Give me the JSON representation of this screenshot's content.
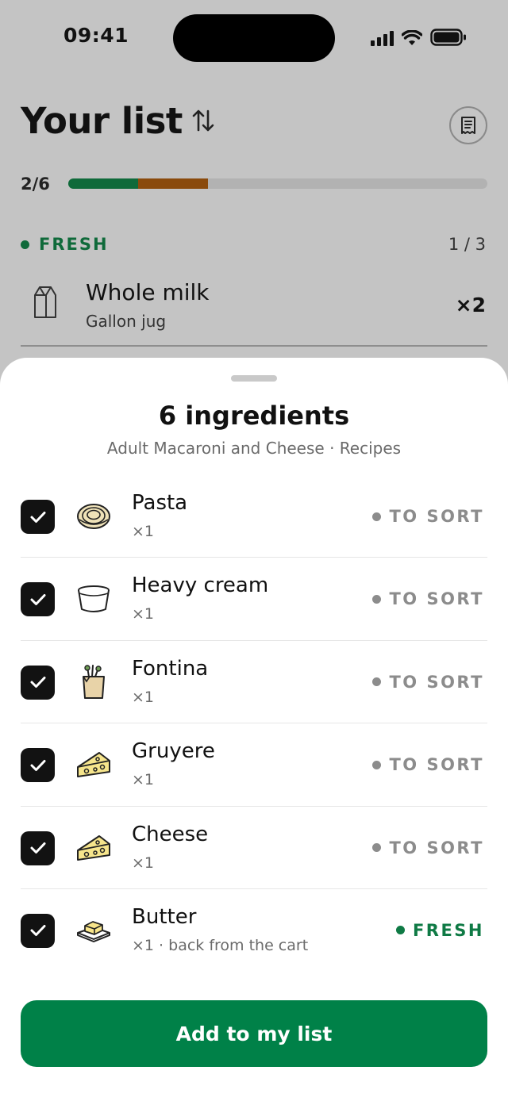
{
  "status_bar": {
    "time": "09:41"
  },
  "list": {
    "title": "Your list",
    "progress": {
      "label": "2/6",
      "fresh_fraction": 0.167,
      "other_fraction": 0.167,
      "fresh_color": "#0f6a3a",
      "other_color": "#8a4a0c"
    },
    "section": {
      "label": "FRESH",
      "count": "1 / 3",
      "color": "#0f6a3a"
    },
    "item": {
      "name": "Whole milk",
      "detail": "Gallon jug",
      "quantity": "×2",
      "icon": "milk-carton-icon"
    }
  },
  "sheet": {
    "title": "6 ingredients",
    "subtitle": "Adult Macaroni and Cheese · Recipes",
    "ingredients": [
      {
        "name": "Pasta",
        "detail": "×1",
        "status": "TO SORT",
        "checked": true,
        "icon": "pasta-icon"
      },
      {
        "name": "Heavy cream",
        "detail": "×1",
        "status": "TO SORT",
        "checked": true,
        "icon": "cream-tub-icon"
      },
      {
        "name": "Fontina",
        "detail": "×1",
        "status": "TO SORT",
        "checked": true,
        "icon": "grocery-bag-icon"
      },
      {
        "name": "Gruyere",
        "detail": "×1",
        "status": "TO SORT",
        "checked": true,
        "icon": "cheese-icon"
      },
      {
        "name": "Cheese",
        "detail": "×1",
        "status": "TO SORT",
        "checked": true,
        "icon": "cheese-icon"
      },
      {
        "name": "Butter",
        "detail": "×1 · back from the cart",
        "status": "FRESH",
        "checked": true,
        "icon": "butter-icon"
      }
    ],
    "cta_label": "Add to my list"
  },
  "colors": {
    "accent": "#008148",
    "fresh": "#0f7a45",
    "to_sort": "#8c8c8c"
  }
}
